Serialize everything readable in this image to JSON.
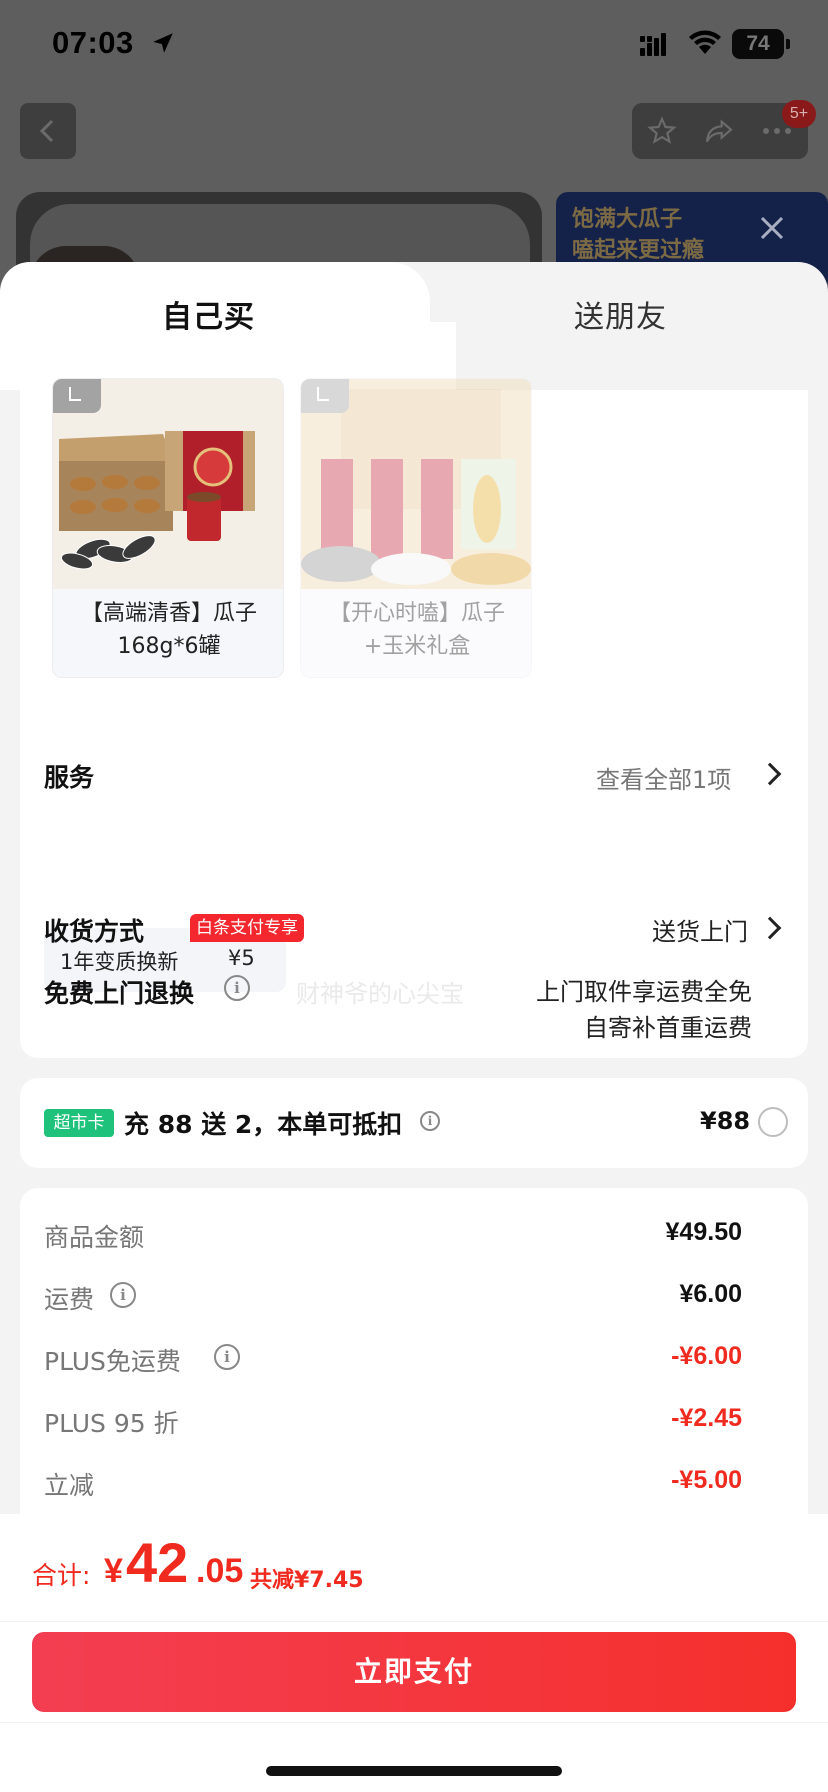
{
  "status_bar": {
    "time": "07:03",
    "battery": "74"
  },
  "background_page": {
    "cart_badge": "5+",
    "ad_lines": [
      "饱满大瓜子",
      "嗑起来更过瘾"
    ]
  },
  "tabs": [
    {
      "label": "自己买",
      "active": true
    },
    {
      "label": "送朋友",
      "active": false
    }
  ],
  "products": [
    {
      "name_line1": "【高端清香】瓜子",
      "name_line2": "168g*6罐",
      "selected": true
    },
    {
      "name_line1": "【开心时嗑】瓜子",
      "name_line2": "+玉米礼盒",
      "selected": false
    }
  ],
  "service": {
    "title": "服务",
    "view_all": "查看全部1项",
    "option": {
      "name": "1年变质换新",
      "price": "¥5",
      "tag": "白条支付专享"
    }
  },
  "watermark": "财神爷的心尖宝",
  "delivery": {
    "title": "收货方式",
    "value": "送货上门"
  },
  "returns": {
    "title": "免费上门退换",
    "line1": "上门取件享运费全免",
    "line2": "自寄补首重运费"
  },
  "market_card": {
    "tag": "超市卡",
    "text": "充 88 送 2，本单可抵扣",
    "price": "¥88"
  },
  "fees": [
    {
      "label": "商品金额",
      "value": "¥49.50",
      "info": false,
      "red": false
    },
    {
      "label": "运费",
      "value": "¥6.00",
      "info": true,
      "red": false
    },
    {
      "label": "PLUS免运费",
      "value": "-¥6.00",
      "info": true,
      "red": true
    },
    {
      "label": "PLUS 95 折",
      "value": "-¥2.45",
      "info": false,
      "red": true
    },
    {
      "label": "立减",
      "value": "-¥5.00",
      "info": false,
      "red": true
    }
  ],
  "total": {
    "label": "合计:",
    "currency": "¥",
    "integer": "42",
    "decimal": ".05",
    "saving": "共减¥7.45"
  },
  "pay_button": "立即支付",
  "colors": {
    "accent_red": "#f02a1e",
    "pay_button": "#f33e52",
    "market_tag": "#1ec27a"
  }
}
